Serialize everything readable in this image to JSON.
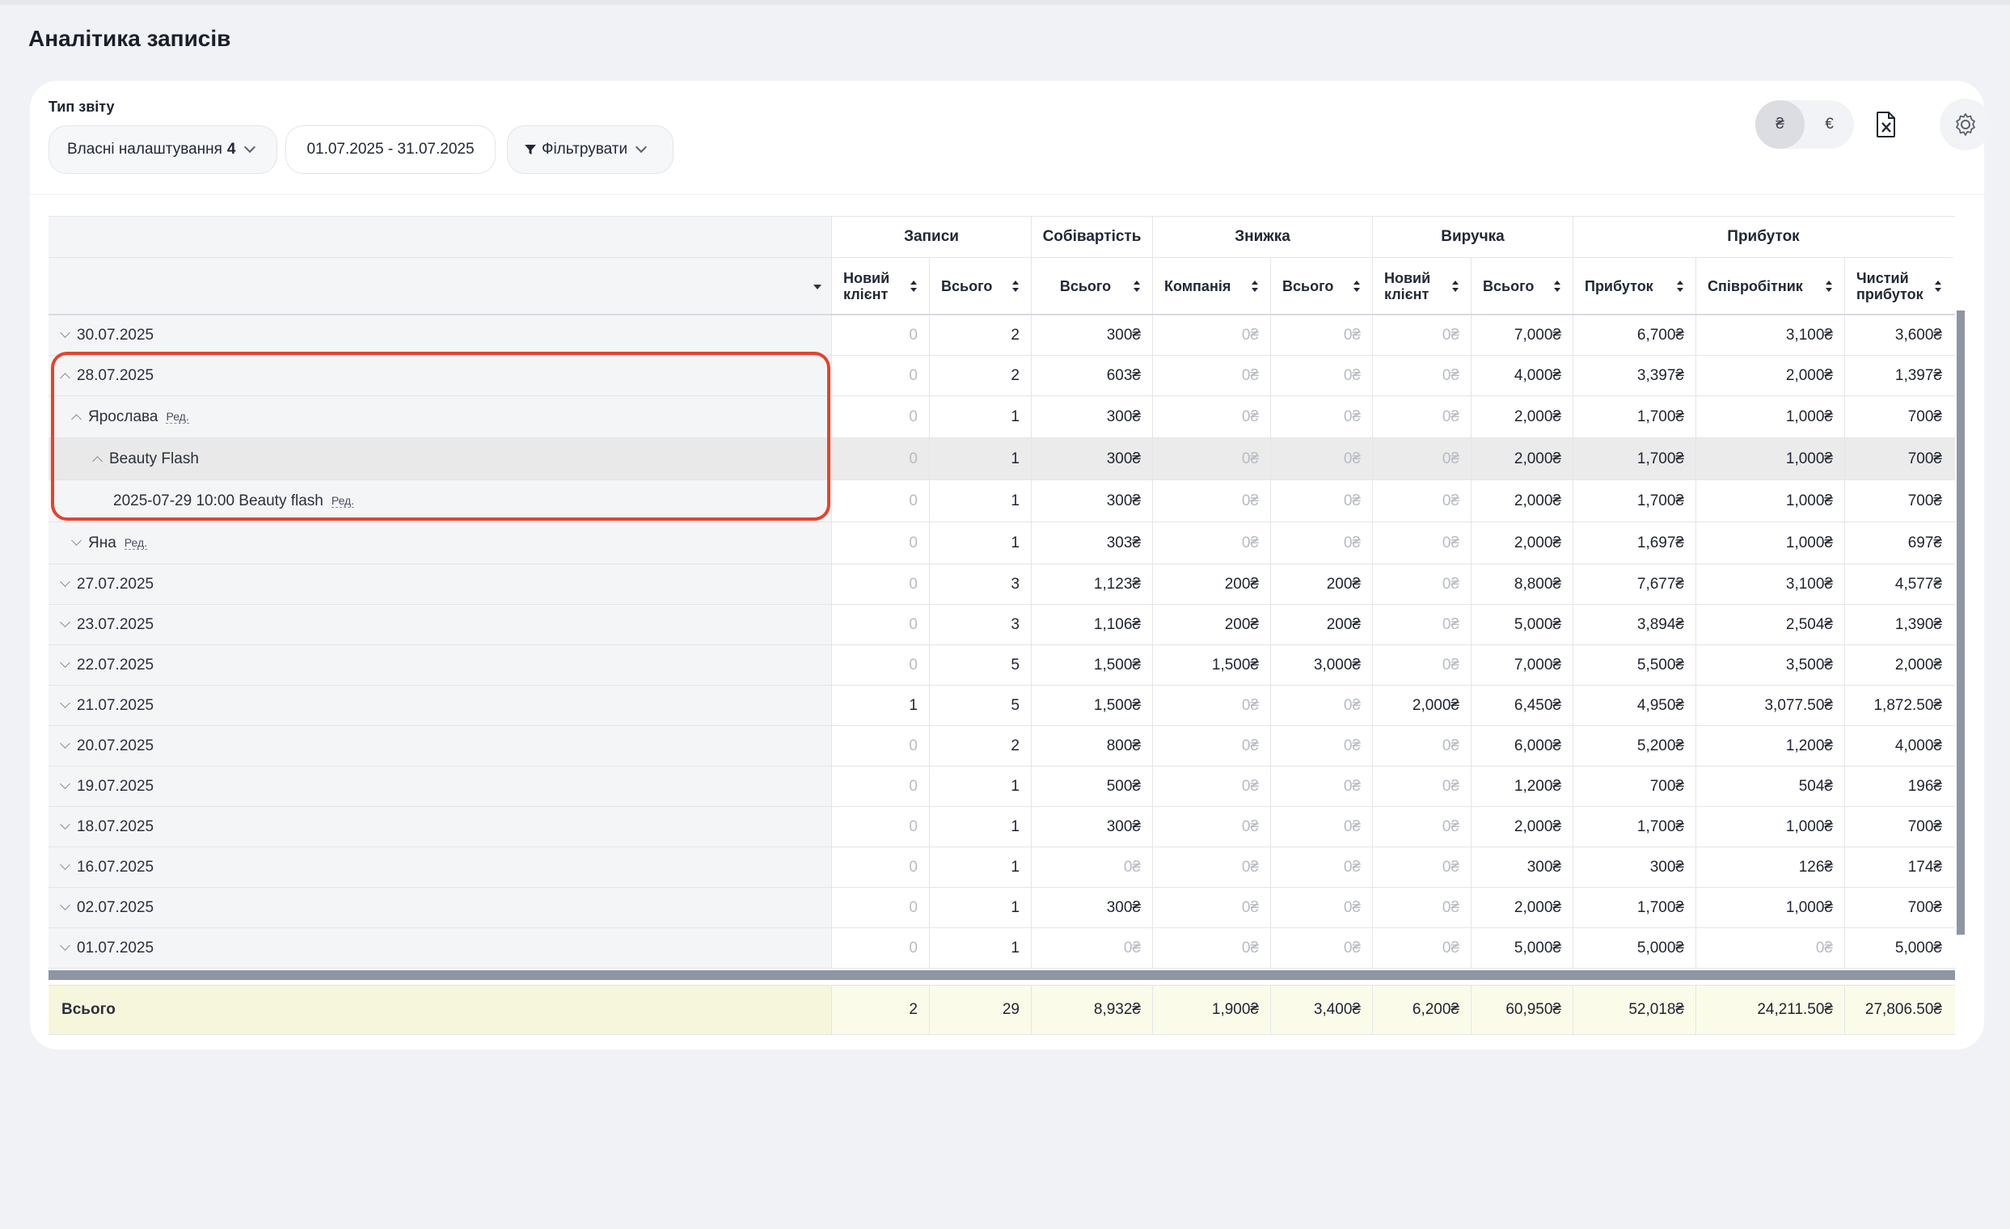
{
  "page": {
    "title": "Аналітика записів"
  },
  "toolbar": {
    "report_type_label": "Тип звіту",
    "settings_label": "Власні налаштування",
    "settings_count": "4",
    "date_range": "01.07.2025 - 31.07.2025",
    "filter_label": "Фільтрувати",
    "currencies": [
      "₴",
      "€"
    ],
    "active_currency": "₴"
  },
  "table": {
    "groups": [
      {
        "label": "Записи"
      },
      {
        "label": "Собівартість"
      },
      {
        "label": "Знижка"
      },
      {
        "label": "Виручка"
      },
      {
        "label": "Прибуток"
      }
    ],
    "columns": [
      "Новий клієнт",
      "Всього",
      "Всього",
      "Компанія",
      "Всього",
      "Новий клієнт",
      "Всього",
      "Прибуток",
      "Співробітник",
      "Чистий прибуток"
    ],
    "rows": [
      {
        "label": "30.07.2025",
        "level": 0,
        "expanded": false,
        "values": [
          "0",
          "2",
          "300₴",
          "0₴",
          "0₴",
          "0₴",
          "7,000₴",
          "6,700₴",
          "3,100₴",
          "3,600₴"
        ]
      },
      {
        "label": "28.07.2025",
        "level": 0,
        "expanded": true,
        "values": [
          "0",
          "2",
          "603₴",
          "0₴",
          "0₴",
          "0₴",
          "4,000₴",
          "3,397₴",
          "2,000₴",
          "1,397₴"
        ]
      },
      {
        "label": "Ярослава",
        "level": 1,
        "expanded": true,
        "edit": "Ред.",
        "values": [
          "0",
          "1",
          "300₴",
          "0₴",
          "0₴",
          "0₴",
          "2,000₴",
          "1,700₴",
          "1,000₴",
          "700₴"
        ]
      },
      {
        "label": "Beauty Flash",
        "level": 2,
        "expanded": true,
        "highlight": true,
        "values": [
          "0",
          "1",
          "300₴",
          "0₴",
          "0₴",
          "0₴",
          "2,000₴",
          "1,700₴",
          "1,000₴",
          "700₴"
        ]
      },
      {
        "label": "2025-07-29 10:00 Beauty flash",
        "level": 3,
        "leaf": true,
        "edit": "Ред.",
        "values": [
          "0",
          "1",
          "300₴",
          "0₴",
          "0₴",
          "0₴",
          "2,000₴",
          "1,700₴",
          "1,000₴",
          "700₴"
        ]
      },
      {
        "label": "Яна",
        "level": 1,
        "expanded": false,
        "edit": "Ред.",
        "values": [
          "0",
          "1",
          "303₴",
          "0₴",
          "0₴",
          "0₴",
          "2,000₴",
          "1,697₴",
          "1,000₴",
          "697₴"
        ]
      },
      {
        "label": "27.07.2025",
        "level": 0,
        "expanded": false,
        "values": [
          "0",
          "3",
          "1,123₴",
          "200₴",
          "200₴",
          "0₴",
          "8,800₴",
          "7,677₴",
          "3,100₴",
          "4,577₴"
        ]
      },
      {
        "label": "23.07.2025",
        "level": 0,
        "expanded": false,
        "values": [
          "0",
          "3",
          "1,106₴",
          "200₴",
          "200₴",
          "0₴",
          "5,000₴",
          "3,894₴",
          "2,504₴",
          "1,390₴"
        ]
      },
      {
        "label": "22.07.2025",
        "level": 0,
        "expanded": false,
        "values": [
          "0",
          "5",
          "1,500₴",
          "1,500₴",
          "3,000₴",
          "0₴",
          "7,000₴",
          "5,500₴",
          "3,500₴",
          "2,000₴"
        ]
      },
      {
        "label": "21.07.2025",
        "level": 0,
        "expanded": false,
        "values": [
          "1",
          "5",
          "1,500₴",
          "0₴",
          "0₴",
          "2,000₴",
          "6,450₴",
          "4,950₴",
          "3,077.50₴",
          "1,872.50₴"
        ]
      },
      {
        "label": "20.07.2025",
        "level": 0,
        "expanded": false,
        "values": [
          "0",
          "2",
          "800₴",
          "0₴",
          "0₴",
          "0₴",
          "6,000₴",
          "5,200₴",
          "1,200₴",
          "4,000₴"
        ]
      },
      {
        "label": "19.07.2025",
        "level": 0,
        "expanded": false,
        "values": [
          "0",
          "1",
          "500₴",
          "0₴",
          "0₴",
          "0₴",
          "1,200₴",
          "700₴",
          "504₴",
          "196₴"
        ]
      },
      {
        "label": "18.07.2025",
        "level": 0,
        "expanded": false,
        "values": [
          "0",
          "1",
          "300₴",
          "0₴",
          "0₴",
          "0₴",
          "2,000₴",
          "1,700₴",
          "1,000₴",
          "700₴"
        ]
      },
      {
        "label": "16.07.2025",
        "level": 0,
        "expanded": false,
        "values": [
          "0",
          "1",
          "0₴",
          "0₴",
          "0₴",
          "0₴",
          "300₴",
          "300₴",
          "126₴",
          "174₴"
        ]
      },
      {
        "label": "02.07.2025",
        "level": 0,
        "expanded": false,
        "values": [
          "0",
          "1",
          "300₴",
          "0₴",
          "0₴",
          "0₴",
          "2,000₴",
          "1,700₴",
          "1,000₴",
          "700₴"
        ]
      },
      {
        "label": "01.07.2025",
        "level": 0,
        "expanded": false,
        "values": [
          "0",
          "1",
          "0₴",
          "0₴",
          "0₴",
          "0₴",
          "5,000₴",
          "5,000₴",
          "0₴",
          "5,000₴"
        ]
      }
    ],
    "total": {
      "label": "Всього",
      "values": [
        "2",
        "29",
        "8,932₴",
        "1,900₴",
        "3,400₴",
        "6,200₴",
        "60,950₴",
        "52,018₴",
        "24,211.50₴",
        "27,806.50₴"
      ]
    }
  },
  "colors": {
    "highlight_box": "#e2442f",
    "zero_text": "#b7bbc4",
    "total_bg": "#fbfbe9"
  }
}
